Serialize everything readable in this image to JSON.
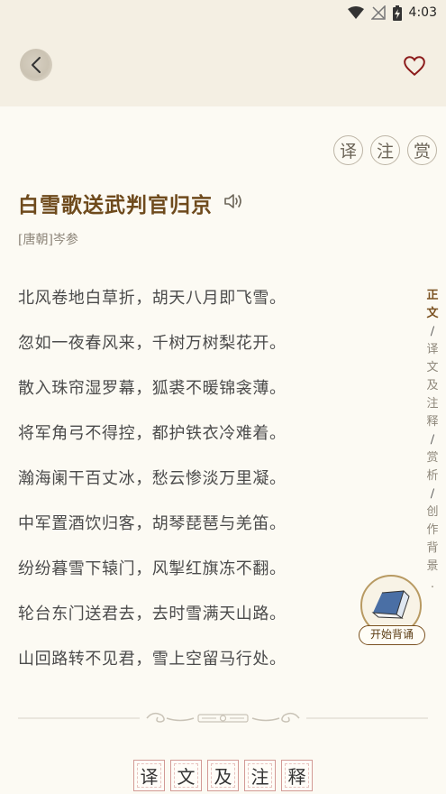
{
  "status": {
    "time": "4:03"
  },
  "poem": {
    "title": "白雪歌送武判官归京",
    "author": "[唐朝]岑参",
    "lines": [
      "北风卷地白草折，胡天八月即飞雪。",
      "忽如一夜春风来，千树万树梨花开。",
      "散入珠帘湿罗幕，狐裘不暖锦衾薄。",
      "将军角弓不得控，都护铁衣冷难着。",
      "瀚海阑干百丈冰，愁云惨淡万里凝。",
      "中军置酒饮归客，胡琴琵琶与羌笛。",
      "纷纷暮雪下辕门，风掣红旗冻不翻。",
      "轮台东门送君去，去时雪满天山路。",
      "山回路转不见君，雪上空留马行处。"
    ]
  },
  "tools": [
    "译",
    "注",
    "赏"
  ],
  "side_nav": {
    "sections": [
      {
        "label": "正文",
        "active": true
      },
      {
        "label": "译文及注释",
        "active": false
      },
      {
        "label": "赏析",
        "active": false
      },
      {
        "label": "创作背景",
        "active": false
      }
    ],
    "separator": "/",
    "suffix": "."
  },
  "recite_button": {
    "label": "开始背诵"
  },
  "section_heading": {
    "chars": [
      "译",
      "文",
      "及",
      "注",
      "释"
    ]
  },
  "icons": {
    "back": "chevron-left-icon",
    "favorite": "heart-outline-icon",
    "speaker": "speaker-icon",
    "wifi": "wifi-icon",
    "signal": "no-signal-icon",
    "battery": "battery-charging-icon",
    "recite": "book-icon"
  },
  "colors": {
    "background": "#fcfaf3",
    "header": "#f4efe3",
    "title": "#6e4a1c",
    "favorite": "#8b1a1a",
    "section_border": "#d29a95"
  }
}
